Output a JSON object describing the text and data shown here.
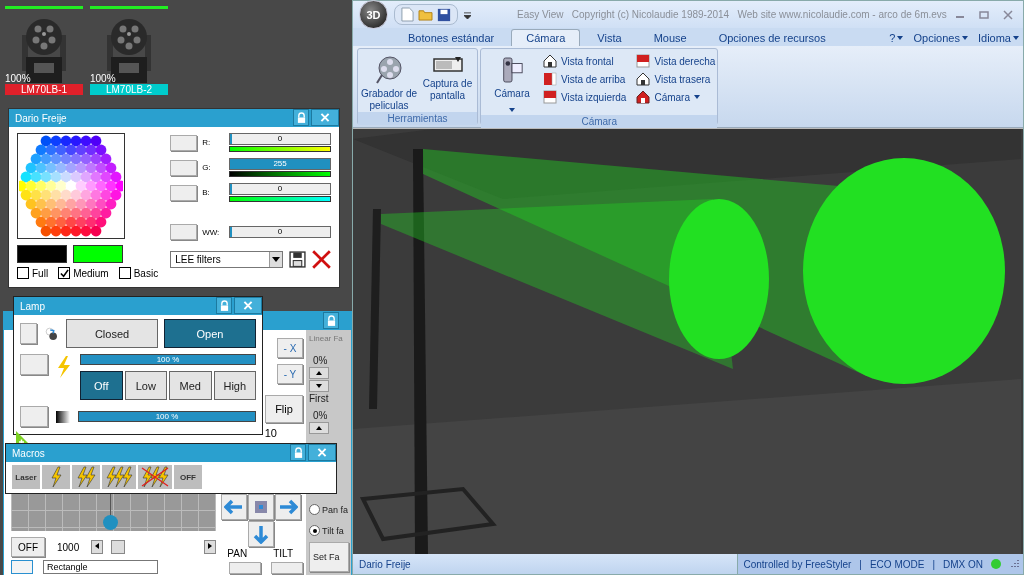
{
  "fixtures": [
    {
      "name": "LM70LB-1",
      "reading": "100%",
      "color": "#e0202a",
      "level": 1
    },
    {
      "name": "LM70LB-2",
      "reading": "100%",
      "color": "#00cccc",
      "level": 1
    }
  ],
  "color_panel": {
    "title": "Dario Freije",
    "channels": [
      {
        "label": "R:",
        "value": "0",
        "level": 0,
        "kind": "red"
      },
      {
        "label": "G:",
        "value": "255",
        "level": 1,
        "kind": "green"
      },
      {
        "label": "B:",
        "value": "0",
        "level": 0,
        "kind": "blue"
      },
      {
        "label": "WW:",
        "value": "0",
        "level": 0,
        "kind": "white"
      }
    ],
    "swatches": [
      {
        "color": "#000000"
      },
      {
        "color": "#00ff00"
      }
    ],
    "options": [
      {
        "label": "Full",
        "checked": false
      },
      {
        "label": "Medium",
        "checked": true
      },
      {
        "label": "Basic",
        "checked": false
      }
    ],
    "filter": "LEE filters"
  },
  "position_panel": {
    "buttons": [
      "- X",
      "- Y"
    ],
    "flip": "Flip",
    "fine": "10",
    "off": "OFF",
    "speed": "1000",
    "shape": "Rectangle",
    "pan": "PAN",
    "tilt": "TILT",
    "fan_title": "Linear Fa",
    "fans": [
      {
        "value": "0%",
        "label": "First"
      },
      {
        "value": "0%"
      }
    ],
    "radios": [
      {
        "label": "Pan fa",
        "selected": false
      },
      {
        "label": "Tilt fa",
        "selected": true
      }
    ],
    "set": "Set Fa"
  },
  "lamp_panel": {
    "title": "Lamp",
    "shutter": [
      {
        "label": "Closed",
        "selected": false
      },
      {
        "label": "Open",
        "selected": true
      }
    ],
    "dimmer": {
      "reading": "100 %",
      "level": 1
    },
    "strobe": [
      {
        "label": "Off",
        "selected": true
      },
      {
        "label": "Low",
        "selected": false
      },
      {
        "label": "Med",
        "selected": false
      },
      {
        "label": "High",
        "selected": false
      }
    ],
    "zoom": {
      "reading": "100 %",
      "level": 1
    }
  },
  "macros_panel": {
    "title": "Macros",
    "buttons": [
      {
        "kind": "text",
        "label": "Laser"
      },
      {
        "kind": "single"
      },
      {
        "kind": "double"
      },
      {
        "kind": "triple"
      },
      {
        "kind": "crossed"
      },
      {
        "kind": "text",
        "label": "OFF"
      }
    ]
  },
  "main_window": {
    "logo": "3D",
    "title": "Easy View   Copyright (c) Nicolaudie 1989-2014   Web site www.nicolaudie.com - arco de 6m.evs",
    "tabs": [
      {
        "label": "Botones estándar",
        "selected": false
      },
      {
        "label": "Cámara",
        "selected": true
      },
      {
        "label": "Vista",
        "selected": false
      },
      {
        "label": "Mouse",
        "selected": false
      },
      {
        "label": "Opciones de recursos",
        "selected": false
      }
    ],
    "menus": [
      "?",
      "Opciones",
      "Idioma"
    ],
    "groups": [
      {
        "label": "Herramientas",
        "items": [
          {
            "kind": "large",
            "label": "Grabador de peliculas"
          },
          {
            "kind": "large",
            "label": "Captura de pantalla"
          }
        ]
      },
      {
        "label": "Cámara",
        "items": [
          {
            "kind": "large",
            "label": "Cámara",
            "dropdown": true
          },
          {
            "kind": "small",
            "label": "Vista frontal"
          },
          {
            "kind": "small",
            "label": "Vista de arriba"
          },
          {
            "kind": "small",
            "label": "Vista izquierda"
          },
          {
            "kind": "small",
            "label": "Vista derecha"
          },
          {
            "kind": "small",
            "label": "Vista trasera"
          },
          {
            "kind": "small",
            "label": "Cámara",
            "dropdown": true
          }
        ]
      }
    ],
    "status": {
      "user": "Dario Freije",
      "items": [
        "Controlled by FreeStyler",
        "|",
        "ECO MODE",
        "|",
        "DMX ON"
      ],
      "dmx_on": true
    }
  }
}
